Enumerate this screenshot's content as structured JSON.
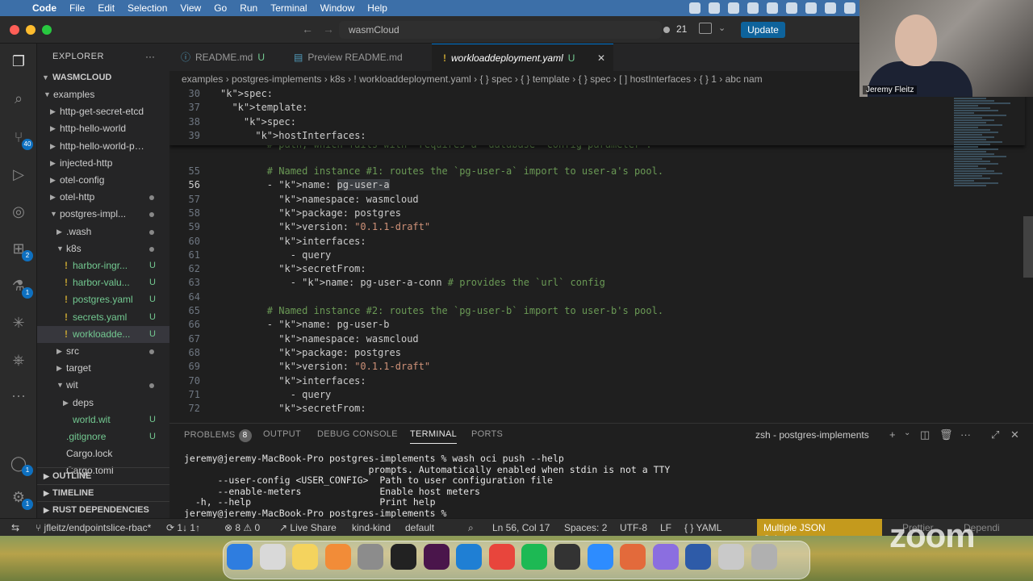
{
  "menubar": {
    "app": "Code",
    "items": [
      "File",
      "Edit",
      "Selection",
      "View",
      "Go",
      "Run",
      "Terminal",
      "Window",
      "Help"
    ]
  },
  "titlebar": {
    "title": "wasmCloud",
    "notifications_count": "21",
    "update_label": "Update"
  },
  "explorer": {
    "header": "EXPLORER",
    "root": "WASMCLOUD",
    "tree": [
      {
        "label": "examples",
        "level": 1,
        "expanded": true
      },
      {
        "label": "http-get-secret-etcd",
        "level": 2
      },
      {
        "label": "http-hello-world",
        "level": 2
      },
      {
        "label": "http-hello-world-pe...",
        "level": 2
      },
      {
        "label": "injected-http",
        "level": 2
      },
      {
        "label": "otel-config",
        "level": 2
      },
      {
        "label": "otel-http",
        "level": 2,
        "dot": true
      },
      {
        "label": "postgres-impl...",
        "level": 2,
        "expanded": true,
        "dot": true
      },
      {
        "label": ".wash",
        "level": 3,
        "dot": true
      },
      {
        "label": "k8s",
        "level": 3,
        "expanded": true,
        "dot": true
      },
      {
        "label": "harbor-ingr...",
        "level": 4,
        "file": true,
        "badge": "U"
      },
      {
        "label": "harbor-valu...",
        "level": 4,
        "file": true,
        "badge": "U"
      },
      {
        "label": "postgres.yaml",
        "level": 4,
        "file": true,
        "badge": "U"
      },
      {
        "label": "secrets.yaml",
        "level": 4,
        "file": true,
        "badge": "U"
      },
      {
        "label": "workloadde...",
        "level": 4,
        "file": true,
        "badge": "U",
        "selected": true
      },
      {
        "label": "src",
        "level": 3,
        "dot": true
      },
      {
        "label": "target",
        "level": 3
      },
      {
        "label": "wit",
        "level": 3,
        "expanded": true,
        "dot": true
      },
      {
        "label": "deps",
        "level": 4
      },
      {
        "label": "world.wit",
        "level": 4,
        "badge": "U"
      },
      {
        "label": ".gitignore",
        "level": 3,
        "badge": "U"
      },
      {
        "label": "Cargo.lock",
        "level": 3
      },
      {
        "label": "Cargo.toml",
        "level": 3
      }
    ],
    "sections": [
      "OUTLINE",
      "TIMELINE",
      "RUST DEPENDENCIES"
    ]
  },
  "tabs": [
    {
      "label": "README.md",
      "suffix": "U"
    },
    {
      "label": "Preview README.md"
    },
    {
      "label": "workloaddeployment.yaml",
      "suffix": "U",
      "active": true
    }
  ],
  "breadcrumb": "examples  ›  postgres-implements  ›  k8s  ›  !  workloaddeployment.yaml  ›  { } spec  ›  { } template  ›  { } spec  ›  [ ] hostInterfaces  ›  { } 1  ›  abc nam",
  "editor": {
    "sticky": [
      {
        "n": "30",
        "text": "spec:"
      },
      {
        "n": "37",
        "text": "  template:"
      },
      {
        "n": "38",
        "text": "    spec:"
      },
      {
        "n": "39",
        "text": "      hostInterfaces:"
      }
    ],
    "partial_line": "        # path, which fails with `requires a 'database' config parameter`.",
    "lines": [
      {
        "n": "55",
        "text": "        # Named instance #1: routes the `pg-user-a` import to user-a's pool."
      },
      {
        "n": "56",
        "text": "        - name: pg-user-a"
      },
      {
        "n": "57",
        "text": "          namespace: wasmcloud"
      },
      {
        "n": "58",
        "text": "          package: postgres"
      },
      {
        "n": "59",
        "text": "          version: \"0.1.1-draft\""
      },
      {
        "n": "60",
        "text": "          interfaces:"
      },
      {
        "n": "61",
        "text": "            - query"
      },
      {
        "n": "62",
        "text": "          secretFrom:"
      },
      {
        "n": "63",
        "text": "            - name: pg-user-a-conn # provides the `url` config"
      },
      {
        "n": "64",
        "text": ""
      },
      {
        "n": "65",
        "text": "        # Named instance #2: routes the `pg-user-b` import to user-b's pool."
      },
      {
        "n": "66",
        "text": "        - name: pg-user-b"
      },
      {
        "n": "67",
        "text": "          namespace: wasmcloud"
      },
      {
        "n": "68",
        "text": "          package: postgres"
      },
      {
        "n": "69",
        "text": "          version: \"0.1.1-draft\""
      },
      {
        "n": "70",
        "text": "          interfaces:"
      },
      {
        "n": "71",
        "text": "            - query"
      },
      {
        "n": "72",
        "text": "          secretFrom:"
      }
    ]
  },
  "panel": {
    "tabs": [
      "PROBLEMS",
      "OUTPUT",
      "DEBUG CONSOLE",
      "TERMINAL",
      "PORTS"
    ],
    "problems_count": "8",
    "active_tab": "TERMINAL",
    "terminal_title": "zsh - postgres-implements",
    "terminal_lines": [
      "jeremy@jeremy-MacBook-Pro postgres-implements % wash oci push --help",
      "                                 prompts. Automatically enabled when stdin is not a TTY",
      "      --user-config <USER_CONFIG>  Path to user configuration file",
      "      --enable-meters              Enable host meters",
      "  -h, --help                       Print help",
      "jeremy@jeremy-MacBook-Pro postgres-implements % "
    ]
  },
  "statusbar": {
    "branch": "jfleitz/endpointslice-rbac*",
    "sync": "1↓ 1↑",
    "errors": "8",
    "warnings": "0",
    "live_share": "Live Share",
    "cluster": "kind-kind",
    "namespace": "default",
    "position": "Ln 56, Col 17",
    "spaces": "Spaces: 2",
    "encoding": "UTF-8",
    "eol": "LF",
    "language": "YAML",
    "warning_msg": "Multiple JSON Schemas...",
    "prettier": "Prettier",
    "dependi": "Dependi"
  },
  "webcam": {
    "name": "Jeremy Fleitz"
  },
  "zoom_watermark": "zoom",
  "dock": [
    {
      "name": "Finder",
      "color": "#2e7de0"
    },
    {
      "name": "Launchpad",
      "color": "#d9d9d9"
    },
    {
      "name": "Notes",
      "color": "#f4d35e"
    },
    {
      "name": "Photos",
      "color": "#f28c38"
    },
    {
      "name": "System Settings",
      "color": "#8c8c8c"
    },
    {
      "name": "Terminal",
      "color": "#222222"
    },
    {
      "name": "Slack",
      "color": "#4a154b"
    },
    {
      "name": "VS Code",
      "color": "#1f7fd4"
    },
    {
      "name": "Chrome",
      "color": "#e8453c"
    },
    {
      "name": "Spotify",
      "color": "#1db954"
    },
    {
      "name": "Grid",
      "color": "#333333"
    },
    {
      "name": "Zoom",
      "color": "#2d8cff"
    },
    {
      "name": "Claude",
      "color": "#e36a3b"
    },
    {
      "name": "Podman",
      "color": "#8b6ee0"
    },
    {
      "name": "Webex",
      "color": "#2e5ba8"
    },
    {
      "name": "Preview",
      "color": "#c9c9c9"
    },
    {
      "name": "Trash",
      "color": "#b0b0b0"
    }
  ]
}
